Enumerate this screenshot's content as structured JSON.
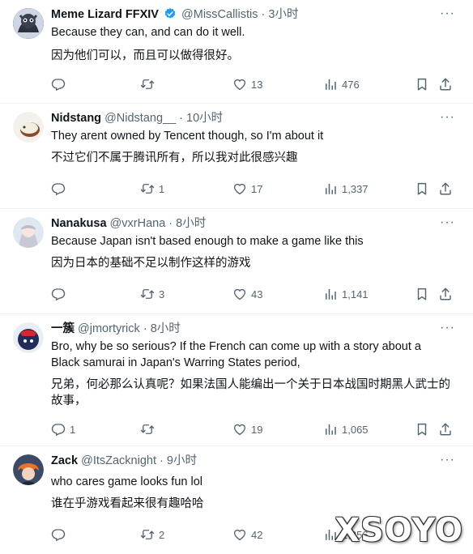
{
  "tweets": [
    {
      "name": "Meme Lizard FFXIV",
      "verified": true,
      "handle": "@MissCallistis",
      "time": "3小时",
      "text_en": "Because they can, and can do it well.",
      "text_zh": "因为他们可以，而且可以做得很好。",
      "replies": "",
      "retweets": "",
      "likes": "13",
      "views": "476"
    },
    {
      "name": "Nidstang",
      "verified": false,
      "handle": "@Nidstang__",
      "time": "10小时",
      "text_en": "They arent owned by Tencent though, so I'm about it",
      "text_zh": "不过它们不属于腾讯所有，所以我对此很感兴趣",
      "replies": "",
      "retweets": "1",
      "likes": "17",
      "views": "1,337"
    },
    {
      "name": "Nanakusa",
      "verified": false,
      "handle": "@vxrHana",
      "time": "8小时",
      "text_en": "Because Japan isn't based enough to make a game like this",
      "text_zh": "因为日本的基础不足以制作这样的游戏",
      "replies": "",
      "retweets": "3",
      "likes": "43",
      "views": "1,141"
    },
    {
      "name": "一簇",
      "verified": false,
      "handle": "@jmortyrick",
      "time": "8小时",
      "text_en_1": "Bro, why be so serious? If the French can come up with a story about a",
      "text_en_2": "Black samurai in Japan's Warring States period,",
      "text_zh_1": "兄弟，何必那么认真呢？如果法国人能编出一个关于日本战国时期黑人武士的",
      "text_zh_2": "故事，",
      "replies": "1",
      "retweets": "",
      "likes": "19",
      "views": "1,065"
    },
    {
      "name": "Zack",
      "verified": false,
      "handle": "@ItsZacknight",
      "time": "9小时",
      "text_en": "who cares game looks fun lol",
      "text_zh": "谁在乎游戏看起来很有趣哈哈",
      "replies": "",
      "retweets": "2",
      "likes": "42",
      "views": "1,256"
    }
  ],
  "separator": "·",
  "more_glyph": "···",
  "watermark": "XSOYO",
  "colors": {
    "text": "#0f1419",
    "muted": "#536471",
    "verified": "#1d9bf0",
    "divider": "#eff3f4"
  },
  "icons": [
    "reply-icon",
    "retweet-icon",
    "like-icon",
    "views-icon",
    "bookmark-icon",
    "share-icon",
    "verified-badge-icon",
    "more-icon"
  ]
}
